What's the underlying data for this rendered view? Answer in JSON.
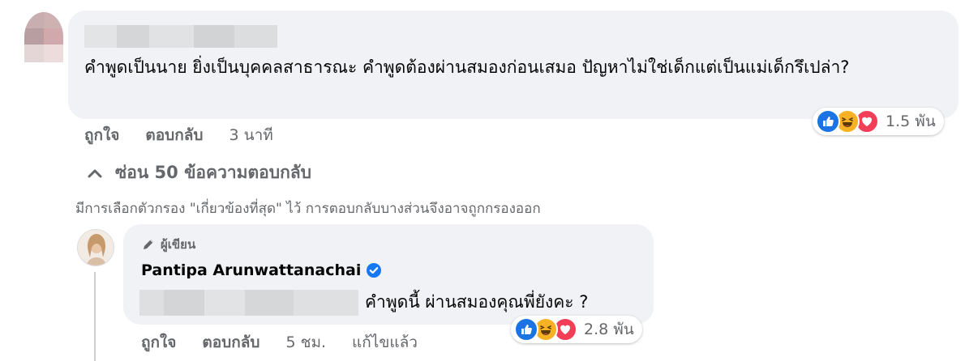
{
  "main_comment": {
    "text": "คำพูดเป็นนาย ยิ่งเป็นบุคคลสาธารณะ คำพูดต้องผ่านสมองก่อนเสมอ ปัญหาไม่ใช่เด็กแต่เป็นแม่เด็กรึเปล่า?",
    "reaction_count": "1.5 พัน",
    "reaction_icons": [
      "like-icon",
      "haha-icon",
      "love-icon"
    ],
    "actions": {
      "like": "ถูกใจ",
      "reply": "ตอบกลับ",
      "time": "3 นาที"
    }
  },
  "hide_replies": "ซ่อน 50 ข้อความตอบกลับ",
  "filter_note": "มีการเลือกตัวกรอง \"เกี่ยวข้องที่สุด\" ไว้ การตอบกลับบางส่วนจึงอาจถูกกรองออก",
  "reply": {
    "author_tag": "ผู้เขียน",
    "author_name": "Pantipa Arunwattanachai",
    "text": "คำพูดนี้ ผ่านสมองคุณพี่ยังคะ ?",
    "reaction_count": "2.8 พัน",
    "reaction_icons": [
      "like-icon",
      "haha-icon",
      "love-icon"
    ],
    "actions": {
      "like": "ถูกใจ",
      "reply": "ตอบกลับ",
      "time": "5 ชม.",
      "edited": "แก้ไขแล้ว"
    }
  },
  "colors": {
    "bubble_bg": "#f0f2f5",
    "secondary_text": "#65676b",
    "like_blue": "#1b74e4",
    "haha_yellow": "#f7b125",
    "love_red": "#f33e58",
    "verified_blue": "#1877f2"
  }
}
